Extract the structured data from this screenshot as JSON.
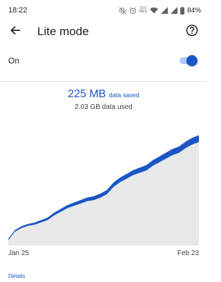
{
  "status_bar": {
    "time": "18:22",
    "network_speed_value": "20.0",
    "network_speed_unit": "KB/S",
    "battery_percent": "84%",
    "icons": [
      "vibrate-off-icon",
      "alarm-icon",
      "network-speed",
      "wifi-icon",
      "signal-icon",
      "signal-icon",
      "battery-icon"
    ]
  },
  "app_bar": {
    "title": "Lite mode",
    "back_icon": "arrow-back-icon",
    "help_icon": "help-outline-icon"
  },
  "toggle": {
    "label": "On",
    "state": "on",
    "accent_color": "#1a56c4",
    "track_color": "#aecbfa"
  },
  "stats": {
    "saved_value": "225 MB",
    "saved_label": "data saved",
    "used_text": "2.03 GB data used"
  },
  "chart_data": {
    "type": "area",
    "x_start_label": "Jan 25",
    "x_end_label": "Feb 23",
    "series": [
      {
        "values": [
          0.05,
          0.12,
          0.15,
          0.17,
          0.18,
          0.2,
          0.22,
          0.26,
          0.29,
          0.32,
          0.34,
          0.36,
          0.38,
          0.39,
          0.41,
          0.44,
          0.5,
          0.54,
          0.57,
          0.6,
          0.62,
          0.64,
          0.68,
          0.71,
          0.74,
          0.77,
          0.79,
          0.83,
          0.86,
          0.88
        ]
      }
    ],
    "colors": {
      "used_area": "#e8e8e8",
      "saved_band": "#1a56c4"
    },
    "grid": false
  },
  "footer": {
    "details_label": "Details"
  }
}
